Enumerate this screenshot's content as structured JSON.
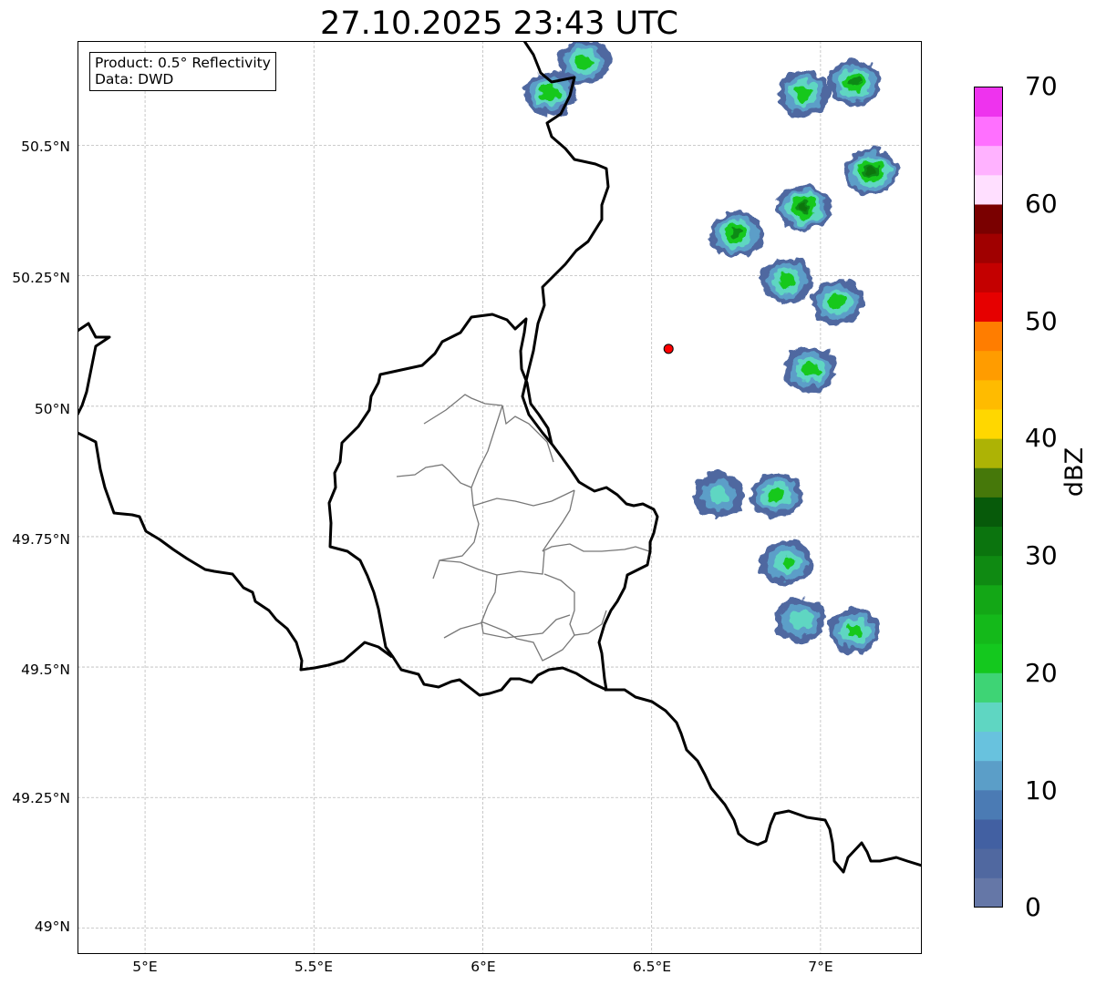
{
  "title": "27.10.2025 23:43 UTC",
  "legend": {
    "product": "Product: 0.5° Reflectivity",
    "source": "Data: DWD"
  },
  "axes": {
    "x_ticks": [
      "5°E",
      "5.5°E",
      "6°E",
      "6.5°E",
      "7°E"
    ],
    "y_ticks": [
      "50.5°N",
      "50.25°N",
      "50°N",
      "49.75°N",
      "49.5°N",
      "49.25°N",
      "49°N"
    ],
    "lon_range": [
      4.8,
      7.3
    ],
    "lat_range": [
      48.95,
      50.7
    ],
    "grid": true
  },
  "colorbar": {
    "label": "dBZ",
    "ticks": [
      "0",
      "10",
      "20",
      "30",
      "40",
      "50",
      "60",
      "70"
    ],
    "range": [
      0,
      70
    ],
    "step": 2.5,
    "colors": [
      "#6577a7",
      "#5068a0",
      "#4260a2",
      "#4b7bb4",
      "#5b9ec8",
      "#68c2de",
      "#5fd6c2",
      "#3ed475",
      "#14c81e",
      "#14b91a",
      "#13a716",
      "#0f8a12",
      "#0b740e",
      "#075a0a",
      "#46780a",
      "#adb305",
      "#ffd700",
      "#ffbb00",
      "#ff9c00",
      "#ff7d00",
      "#e60000",
      "#c40000",
      "#a00000",
      "#7a0000",
      "#ffdfff",
      "#ffb2ff",
      "#ff70ff",
      "#ee33ee"
    ]
  },
  "site_marker": {
    "lon": 6.55,
    "lat": 50.11,
    "color": "#ff0000"
  },
  "chart_data": {
    "type": "heatmap",
    "title": "27.10.2025 23:43 UTC",
    "xlabel": "",
    "ylabel": "",
    "colorbar_label": "dBZ",
    "color_range": [
      0,
      70
    ],
    "lon_range": [
      4.8,
      7.3
    ],
    "lat_range": [
      48.95,
      50.7
    ],
    "precip_cells": [
      {
        "lon": 6.95,
        "lat": 50.38,
        "max_dbz": 32
      },
      {
        "lon": 7.15,
        "lat": 50.45,
        "max_dbz": 33
      },
      {
        "lon": 6.75,
        "lat": 50.33,
        "max_dbz": 28
      },
      {
        "lon": 6.95,
        "lat": 50.6,
        "max_dbz": 25
      },
      {
        "lon": 7.1,
        "lat": 50.62,
        "max_dbz": 28
      },
      {
        "lon": 6.2,
        "lat": 50.6,
        "max_dbz": 25
      },
      {
        "lon": 6.3,
        "lat": 50.66,
        "max_dbz": 25
      },
      {
        "lon": 6.9,
        "lat": 50.24,
        "max_dbz": 25
      },
      {
        "lon": 7.05,
        "lat": 50.2,
        "max_dbz": 25
      },
      {
        "lon": 6.97,
        "lat": 50.07,
        "max_dbz": 25
      },
      {
        "lon": 6.87,
        "lat": 49.83,
        "max_dbz": 24
      },
      {
        "lon": 6.7,
        "lat": 49.83,
        "max_dbz": 18
      },
      {
        "lon": 6.9,
        "lat": 49.7,
        "max_dbz": 22
      },
      {
        "lon": 7.1,
        "lat": 49.57,
        "max_dbz": 24
      },
      {
        "lon": 6.94,
        "lat": 49.59,
        "max_dbz": 20
      }
    ]
  }
}
